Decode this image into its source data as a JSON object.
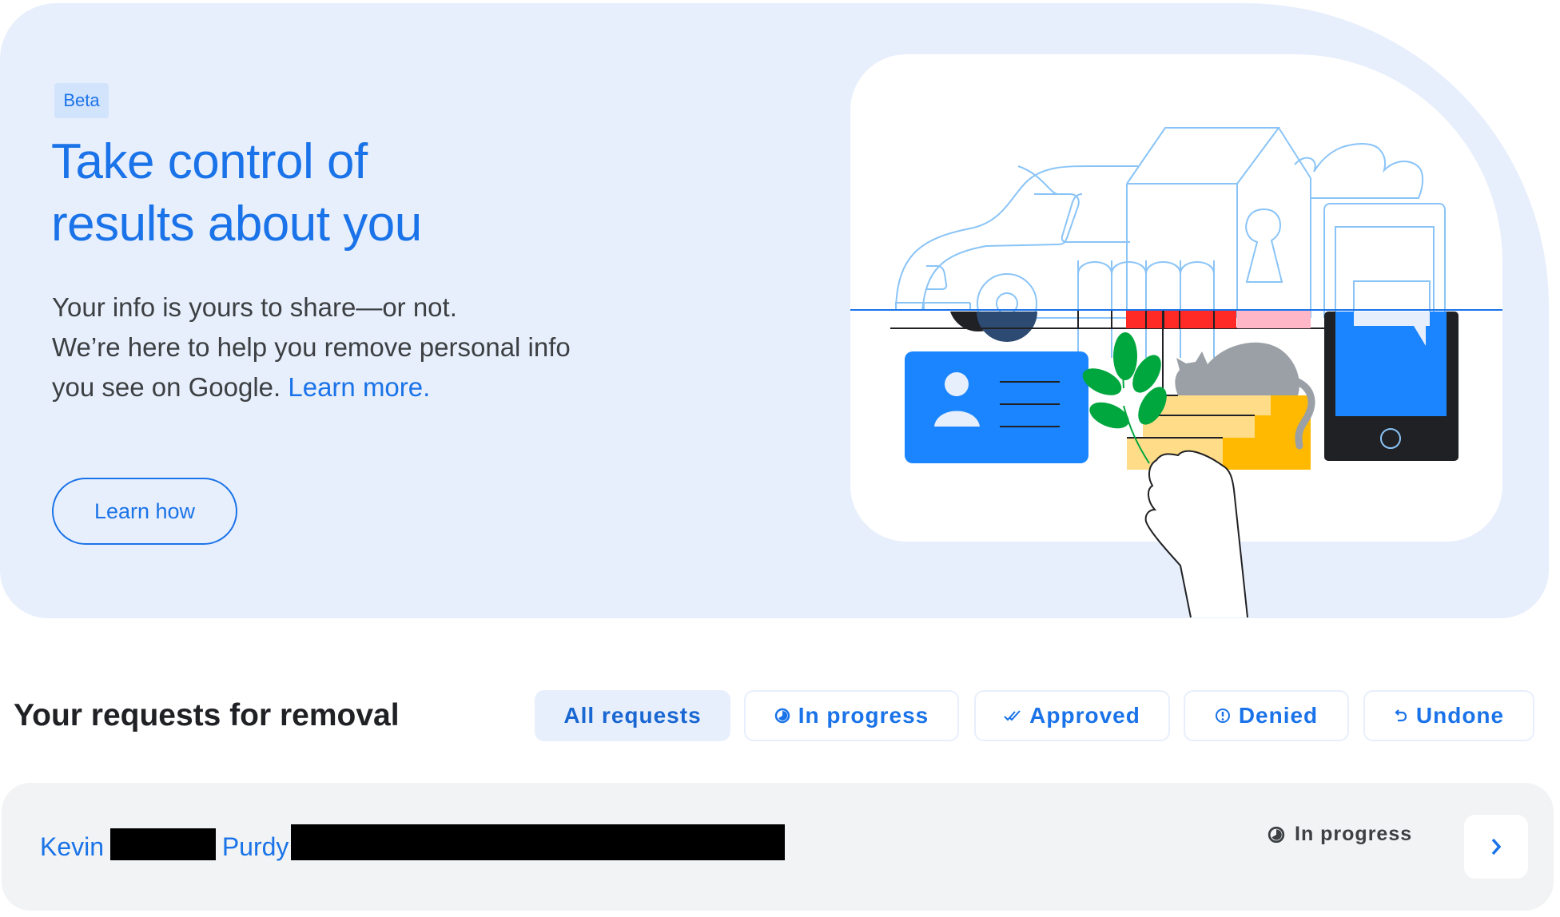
{
  "hero": {
    "badge": "Beta",
    "title_line1": "Take control of",
    "title_line2": "results about you",
    "body_line1": "Your info is yours to share—or not.",
    "body_line2": "We’re here to help you remove personal info",
    "body_line3": "you see on Google. ",
    "learn_more_link": "Learn more.",
    "learn_how_button": "Learn how",
    "illustration": "privacy-illustration"
  },
  "requests": {
    "title": "Your requests for removal",
    "filters": [
      {
        "label": "All requests",
        "icon": "none",
        "active": true
      },
      {
        "label": "In progress",
        "icon": "clock-half-icon",
        "active": false
      },
      {
        "label": "Approved",
        "icon": "double-check-icon",
        "active": false
      },
      {
        "label": "Denied",
        "icon": "alert-circle-icon",
        "active": false
      },
      {
        "label": "Undone",
        "icon": "undo-icon",
        "active": false
      }
    ],
    "items": [
      {
        "name_first": "Kevin",
        "name_last": "Purdy",
        "redacted": true,
        "status": "In progress",
        "status_icon": "clock-half-icon"
      }
    ]
  },
  "colors": {
    "accent": "#1a73e8",
    "banner_bg": "#e8effc",
    "row_bg": "#f1f3f4"
  }
}
